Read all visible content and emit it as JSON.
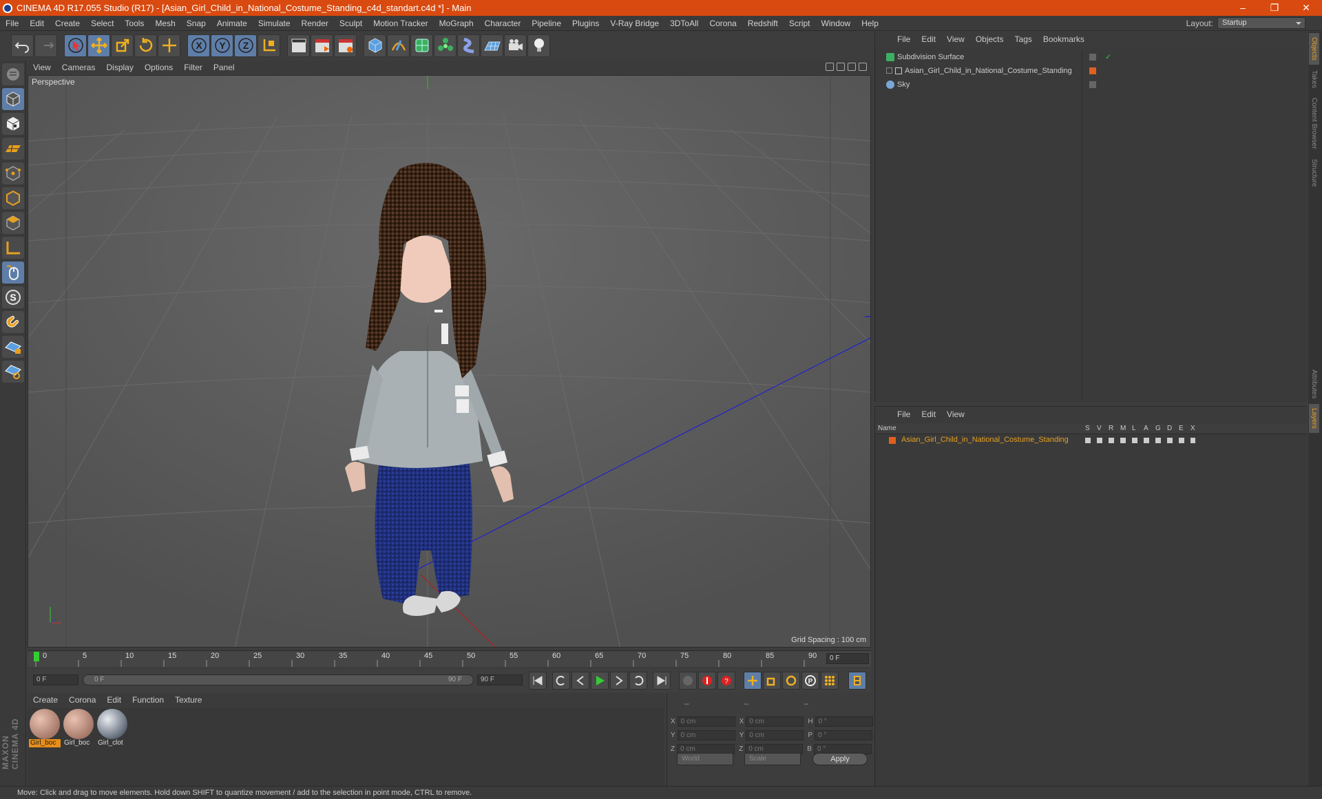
{
  "app": {
    "title": "CINEMA 4D R17.055 Studio (R17) - [Asian_Girl_Child_in_National_Costume_Standing_c4d_standart.c4d *] - Main",
    "win_min": "–",
    "win_restore": "❐",
    "win_close": "✕"
  },
  "menu": [
    "File",
    "Edit",
    "Create",
    "Select",
    "Tools",
    "Mesh",
    "Snap",
    "Animate",
    "Simulate",
    "Render",
    "Sculpt",
    "Motion Tracker",
    "MoGraph",
    "Character",
    "Pipeline",
    "Plugins",
    "V-Ray Bridge",
    "3DToAll",
    "Corona",
    "Redshift",
    "Script",
    "Window",
    "Help"
  ],
  "layout": {
    "label": "Layout:",
    "value": "Startup"
  },
  "viewport": {
    "menu": [
      "View",
      "Cameras",
      "Display",
      "Options",
      "Filter",
      "Panel"
    ],
    "label": "Perspective",
    "grid_spacing": "Grid Spacing : 100 cm"
  },
  "timeline": {
    "ticks": [
      "0",
      "5",
      "10",
      "15",
      "20",
      "25",
      "30",
      "35",
      "40",
      "45",
      "50",
      "55",
      "60",
      "65",
      "70",
      "75",
      "80",
      "85",
      "90"
    ],
    "current_frame": "0 F",
    "start_field": "0 F",
    "range_start": "0 F",
    "range_end": "90 F",
    "end_field": "90 F"
  },
  "materials": {
    "menu": [
      "Create",
      "Corona",
      "Edit",
      "Function",
      "Texture"
    ],
    "items": [
      {
        "name": "Girl_boc",
        "selected": true,
        "color": "#b07a68"
      },
      {
        "name": "Girl_boc",
        "selected": false,
        "color": "#b07a68"
      },
      {
        "name": "Girl_clot",
        "selected": false,
        "color": "#8a9aac"
      }
    ]
  },
  "coords": {
    "headers": [
      "--",
      "--",
      "--"
    ],
    "rows": [
      {
        "a": "X",
        "av": "0 cm",
        "b": "X",
        "bv": "0 cm",
        "c": "H",
        "cv": "0 °"
      },
      {
        "a": "Y",
        "av": "0 cm",
        "b": "Y",
        "bv": "0 cm",
        "c": "P",
        "cv": "0 °"
      },
      {
        "a": "Z",
        "av": "0 cm",
        "b": "Z",
        "bv": "0 cm",
        "c": "B",
        "cv": "0 °"
      }
    ],
    "mode": "World",
    "type": "Scale",
    "apply": "Apply"
  },
  "objects": {
    "menu": [
      "File",
      "Edit",
      "View",
      "Objects",
      "Tags",
      "Bookmarks"
    ],
    "items": [
      {
        "name": "Subdivision Surface"
      },
      {
        "name": "Asian_Girl_Child_in_National_Costume_Standing"
      },
      {
        "name": "Sky"
      }
    ]
  },
  "layers": {
    "menu": [
      "File",
      "Edit",
      "View"
    ],
    "columns": {
      "name": "Name",
      "flags": [
        "S",
        "V",
        "R",
        "M",
        "L",
        "A",
        "G",
        "D",
        "E",
        "X"
      ]
    },
    "item": "Asian_Girl_Child_in_National_Costume_Standing"
  },
  "side_tabs": [
    "Objects",
    "Takes",
    "Content Browser",
    "Structure"
  ],
  "side_tabs_lower": [
    "Attributes",
    "Layers"
  ],
  "maxon": "MAXON CINEMA 4D",
  "status": "Move: Click and drag to move elements. Hold down SHIFT to quantize movement / add to the selection in point mode, CTRL to remove.",
  "colors": {
    "titlebar": "#d94a10",
    "accent": "#e8a020",
    "active_tool": "#5e7ea8"
  }
}
